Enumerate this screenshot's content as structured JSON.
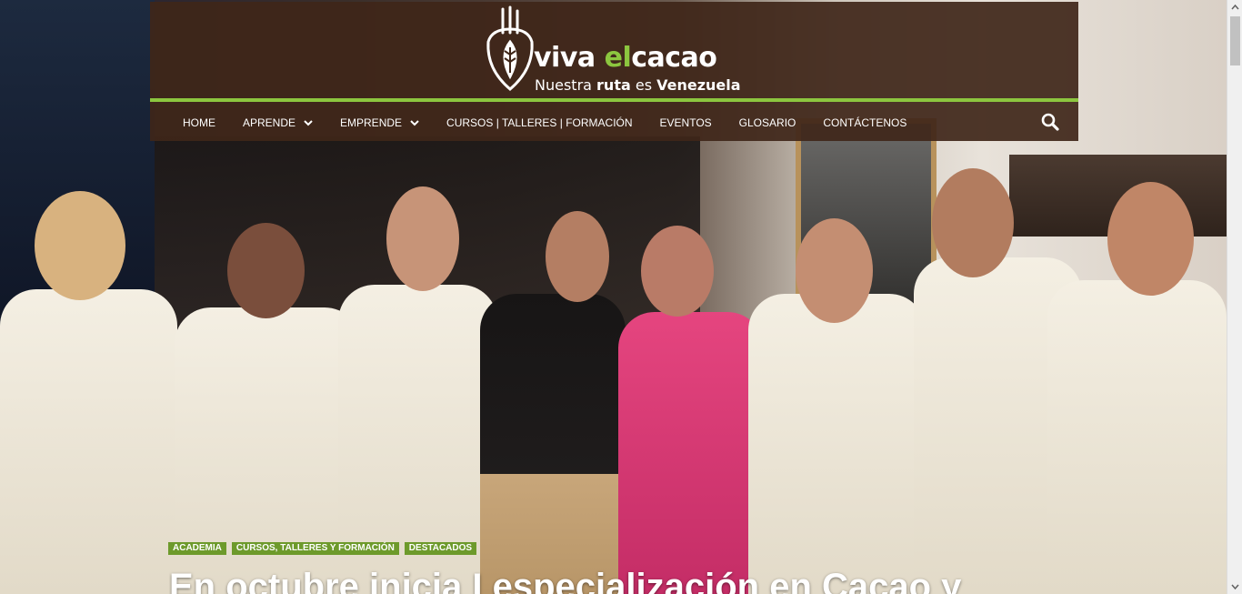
{
  "logo": {
    "word_viva": "viva ",
    "word_el": "el",
    "word_cacao": "cacao",
    "tagline_part1": "Nuestra ",
    "tagline_part2": "ruta",
    "tagline_part3": " es ",
    "tagline_part4": "Venezuela"
  },
  "nav": {
    "items": [
      {
        "label": "HOME",
        "has_dropdown": false
      },
      {
        "label": "APRENDE",
        "has_dropdown": true
      },
      {
        "label": "EMPRENDE",
        "has_dropdown": true
      },
      {
        "label": "CURSOS | TALLERES | FORMACIÓN",
        "has_dropdown": false
      },
      {
        "label": "EVENTOS",
        "has_dropdown": false
      },
      {
        "label": "GLOSARIO",
        "has_dropdown": false
      },
      {
        "label": "CONTÁCTENOS",
        "has_dropdown": false
      }
    ],
    "search_icon": "search-icon"
  },
  "post": {
    "tags": [
      "ACADEMIA",
      "CURSOS, TALLERES Y FORMACIÓN",
      "DESTACADOS"
    ],
    "title": "En octubre inicia I especialización en Cacao y"
  },
  "colors": {
    "header_bg": "#3f2619",
    "accent_green": "#8cc63f",
    "tag_green": "#6d9a2b"
  }
}
